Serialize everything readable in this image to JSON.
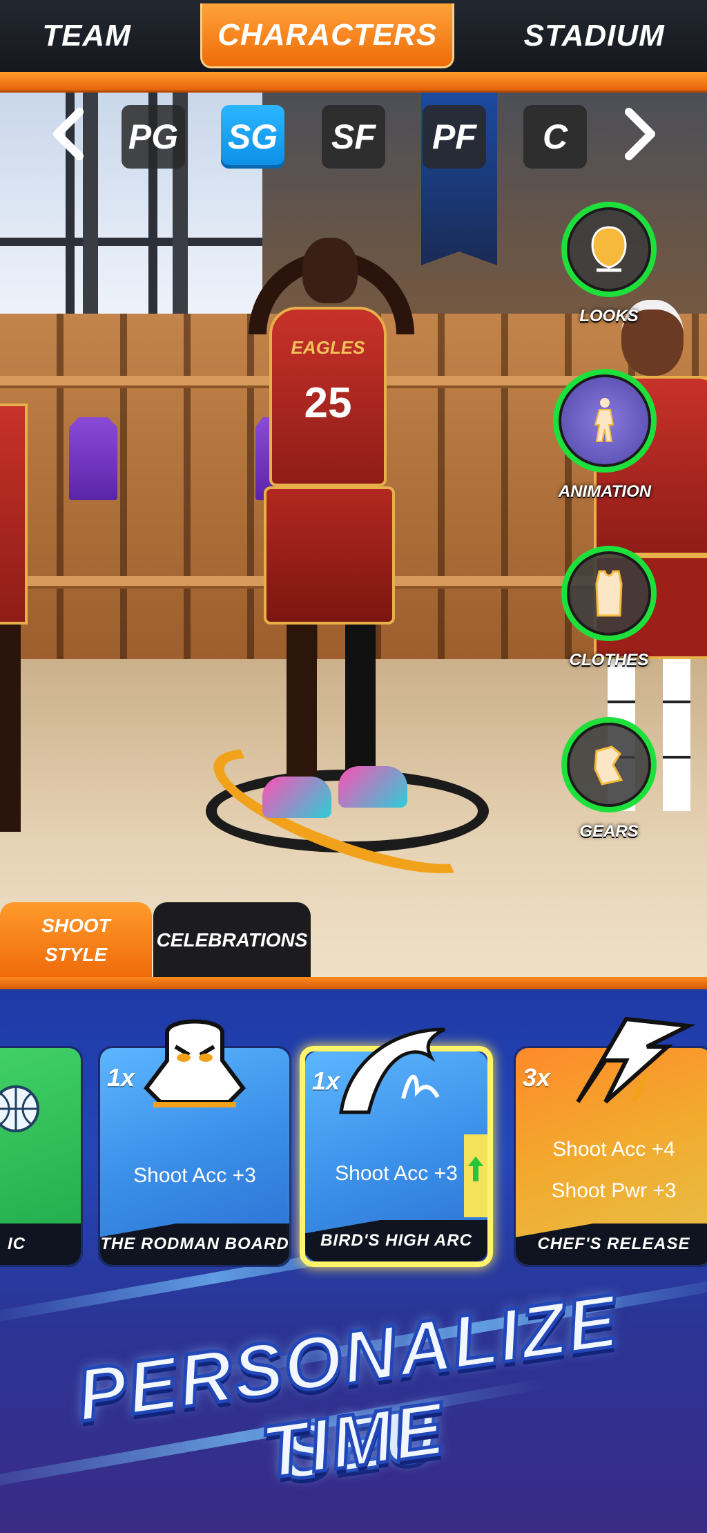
{
  "top_nav": {
    "tabs": [
      "TEAM",
      "CHARACTERS",
      "STADIUM"
    ],
    "active": "CHARACTERS"
  },
  "positions": {
    "items": [
      "PG",
      "SG",
      "SF",
      "PF",
      "C"
    ],
    "active": "SG"
  },
  "customize": {
    "looks": "LOOKS",
    "animation": "ANIMATION",
    "clothes": "CLOTHES",
    "gears": "GEARS"
  },
  "style_tabs": {
    "shoot_style_line1": "SHOOT",
    "shoot_style_line2": "STYLE",
    "celebrations": "CELEBRATIONS"
  },
  "player": {
    "team": "EAGLES",
    "number": "25"
  },
  "cards": [
    {
      "name": "IC",
      "mult": "",
      "stats": []
    },
    {
      "name": "THE RODMAN BOARD",
      "mult": "1x",
      "stats": [
        "Shoot Acc +3"
      ]
    },
    {
      "name": "BIRD'S HIGH ARC",
      "mult": "1x",
      "stats": [
        "Shoot Acc +3"
      ],
      "selected": true
    },
    {
      "name": "CHEF'S RELEASE",
      "mult": "3x",
      "stats": [
        "Shoot Acc +4",
        "Shoot Pwr +3"
      ]
    }
  ],
  "promo": {
    "line1": "PERSONALIZE SEU",
    "line2": "TIME"
  },
  "colors": {
    "accent_orange": "#ef6c08",
    "active_blue": "#0a8ee6",
    "ring_green": "#1ee03a",
    "selected_gold": "#fff46a"
  }
}
